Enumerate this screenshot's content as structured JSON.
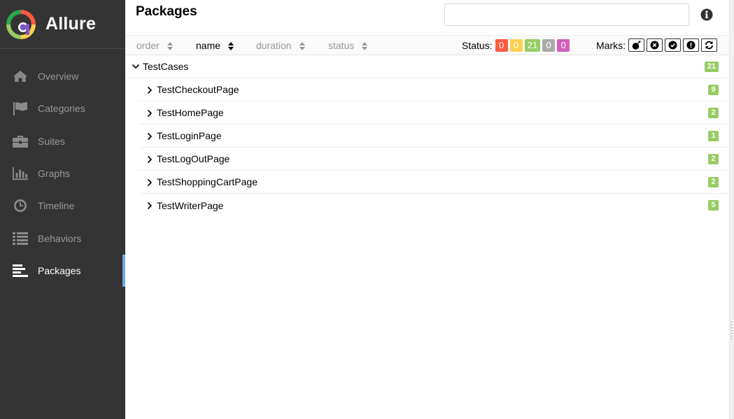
{
  "app": {
    "name": "Allure"
  },
  "colors": {
    "sidebar_bg": "#343434",
    "accent": "#6ea9e8",
    "failed": "#fd5a3e",
    "broken": "#ffd050",
    "passed": "#97cc64",
    "skipped": "#aaaaaa",
    "unknown": "#d35ebe"
  },
  "sidebar": {
    "items": [
      {
        "label": "Overview",
        "icon": "home-icon"
      },
      {
        "label": "Categories",
        "icon": "flag-icon"
      },
      {
        "label": "Suites",
        "icon": "briefcase-icon"
      },
      {
        "label": "Graphs",
        "icon": "bar-chart-icon"
      },
      {
        "label": "Timeline",
        "icon": "clock-icon"
      },
      {
        "label": "Behaviors",
        "icon": "list-icon"
      },
      {
        "label": "Packages",
        "icon": "align-left-icon",
        "active": true
      }
    ]
  },
  "header": {
    "title": "Packages",
    "search_placeholder": "",
    "search_value": ""
  },
  "toolbar": {
    "sort": [
      {
        "label": "order",
        "active": false
      },
      {
        "label": "name",
        "active": true
      },
      {
        "label": "duration",
        "active": false
      },
      {
        "label": "status",
        "active": false
      }
    ],
    "status_label": "Status:",
    "status_counts": [
      {
        "status": "failed",
        "value": "0"
      },
      {
        "status": "broken",
        "value": "0"
      },
      {
        "status": "passed",
        "value": "21"
      },
      {
        "status": "skipped",
        "value": "0"
      },
      {
        "status": "unknown",
        "value": "0"
      }
    ],
    "marks_label": "Marks:",
    "marks": [
      "flaky-icon",
      "new-failed-icon",
      "new-passed-icon",
      "new-broken-icon",
      "retries-icon"
    ]
  },
  "tree": {
    "root": {
      "label": "TestCases",
      "count": "21",
      "expanded": true
    },
    "children": [
      {
        "label": "TestCheckoutPage",
        "count": "9"
      },
      {
        "label": "TestHomePage",
        "count": "2"
      },
      {
        "label": "TestLoginPage",
        "count": "1"
      },
      {
        "label": "TestLogOutPage",
        "count": "2"
      },
      {
        "label": "TestShoppingCartPage",
        "count": "2"
      },
      {
        "label": "TestWriterPage",
        "count": "5"
      }
    ]
  }
}
